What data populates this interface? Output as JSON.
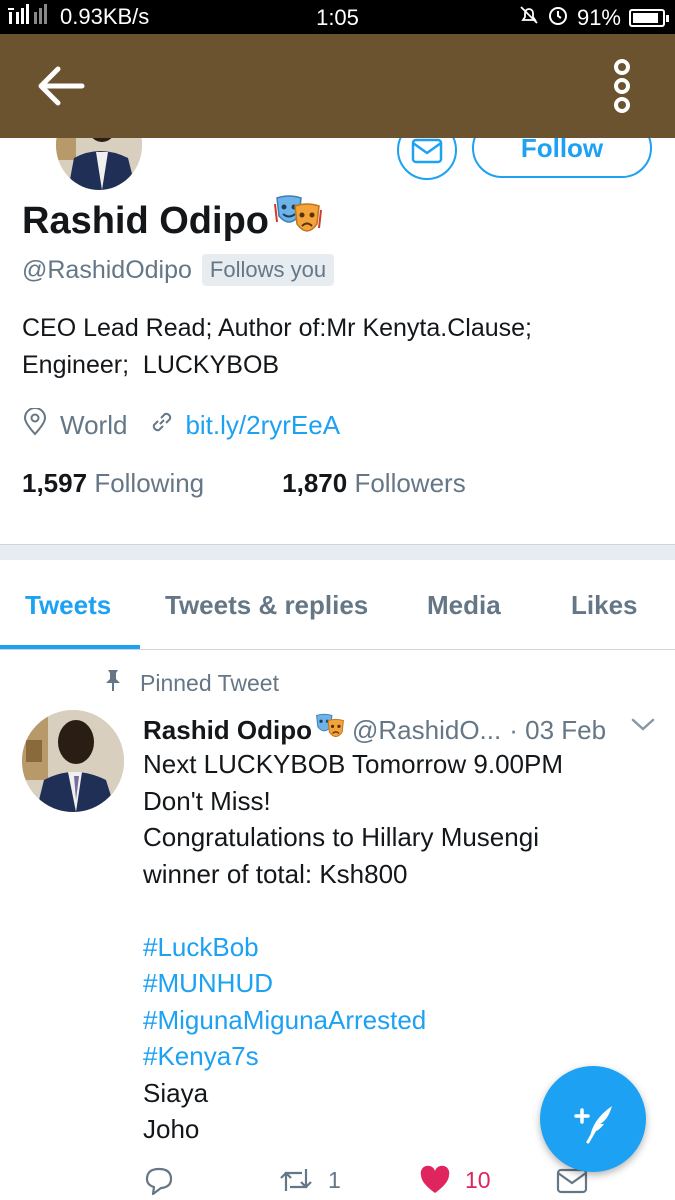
{
  "status_bar": {
    "network_speed": "0.93KB/s",
    "time": "1:05",
    "battery": "91%",
    "battery_level": 0.91
  },
  "profile": {
    "name": "Rashid Odipo",
    "handle": "@RashidOdipo",
    "follows_you": "Follows you",
    "bio_line1": "CEO Lead Read; Author of:Mr Kenyta.Clause;",
    "bio_line2": "Engineer;  LUCKYBOB",
    "location": "World",
    "website": "bit.ly/2ryrEeA",
    "following_count": "1,597",
    "following_label": "Following",
    "followers_count": "1,870",
    "followers_label": "Followers",
    "follow_button": "Follow"
  },
  "tabs": [
    {
      "label": "Tweets",
      "active": true
    },
    {
      "label": "Tweets & replies"
    },
    {
      "label": "Media"
    },
    {
      "label": "Likes"
    }
  ],
  "tweet": {
    "pinned_label": "Pinned Tweet",
    "author_name": "Rashid Odipo",
    "author_handle": "@RashidO...",
    "date": "· 03 Feb",
    "lines": [
      "Next LUCKYBOB Tomorrow 9.00PM",
      "Don't Miss!",
      "Congratulations to Hillary Musengi",
      "winner of total: Ksh800"
    ],
    "hashtags": [
      "#LuckBob",
      "#MUNHUD",
      "#MigunaMigunaArrested",
      "#Kenya7s"
    ],
    "trailing_lines": [
      "Siaya",
      "Joho"
    ],
    "retweets": "1",
    "likes": "10"
  },
  "colors": {
    "header": "#6b5330",
    "accent": "#1da1f2",
    "like": "#e0245e"
  },
  "icons": [
    "back-arrow-icon",
    "more-options-icon",
    "mail-icon",
    "theater-masks-emoji-icon",
    "location-pin-icon",
    "link-icon",
    "pin-icon",
    "chevron-down-icon",
    "reply-icon",
    "retweet-icon",
    "heart-icon",
    "compose-icon"
  ]
}
